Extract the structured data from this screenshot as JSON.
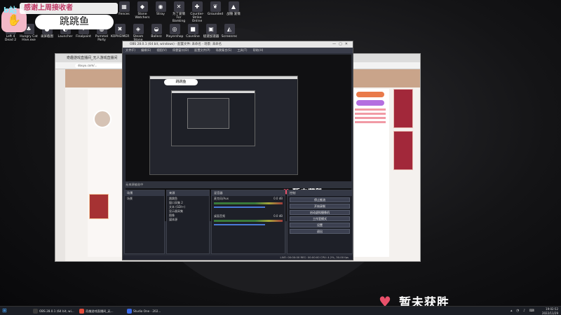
{
  "desktop": {
    "stream_title": "感谢上周接收者",
    "stream_badge": "b站",
    "bubble_text": "跳跳鱼",
    "icons": [
      {
        "label": "Fences",
        "glyph": "▦"
      },
      {
        "label": "Stone Watchers",
        "glyph": "◆"
      },
      {
        "label": "Stray",
        "glyph": "◉"
      },
      {
        "label": "为了爱情 For Banking",
        "glyph": "✕"
      },
      {
        "label": "Counter-Strike Online",
        "glyph": "✚"
      },
      {
        "label": "Grounded",
        "glyph": "❦"
      },
      {
        "label": "战锤 爱情",
        "glyph": "▲"
      },
      {
        "label": "Left 4 Dead 2",
        "glyph": "✶"
      },
      {
        "label": "Hungry Cat Hive.exe",
        "glyph": "♣"
      },
      {
        "label": "录屏截图",
        "glyph": "●"
      },
      {
        "label": "Launcher",
        "glyph": "◐"
      },
      {
        "label": "Finalpoint",
        "glyph": "✦"
      },
      {
        "label": "Pummel Party",
        "glyph": "◍"
      },
      {
        "label": "KOPHEIMER",
        "glyph": "✖"
      },
      {
        "label": "Steam Stone Giant",
        "glyph": "◈"
      },
      {
        "label": "Ballerz",
        "glyph": "◒"
      },
      {
        "label": "Playershop",
        "glyph": "◎"
      },
      {
        "label": "Caveline",
        "glyph": "■"
      },
      {
        "label": "极速加速器",
        "glyph": "▣"
      },
      {
        "label": "Screenrec",
        "glyph": "◭"
      },
      {
        "label": "腾讯 Firefist",
        "glyph": "✗"
      }
    ],
    "status_text": "暂未获胜"
  },
  "browser": {
    "tab_title": "奇趣游戏直播间_无人游戏直播间",
    "url": "douyu.com/..."
  },
  "obs": {
    "title": "OBS 28.0.1 (64 bit, windows) - 配置文件: 未命名 - 场景: 未命名",
    "menu": [
      "文件(F)",
      "编辑(E)",
      "视图(V)",
      "停靠窗口(D)",
      "配置文件(P)",
      "场景集合(S)",
      "工具(T)",
      "帮助(H)"
    ],
    "mini_bubble": "跳跳鱼",
    "preview_status": "暂未获胜",
    "scene_bar": "无来源被选中",
    "docks": {
      "scenes": {
        "title": "场景",
        "items": [
          "场景"
        ]
      },
      "sources": {
        "title": "来源",
        "items": [
          "跳跳鱼",
          "窗口采集 2",
          "文本 (GDI+)",
          "显示器采集",
          "图像",
          "媒体源"
        ]
      },
      "mixer": {
        "title": "混音器",
        "channels": [
          {
            "name": "麦克风/Aux",
            "level": "0.0 dB"
          },
          {
            "name": "桌面音频",
            "level": "0.0 dB"
          }
        ]
      },
      "controls": {
        "title": "控制",
        "buttons": [
          "停止推流",
          "开始录制",
          "启动虚拟摄像机",
          "工作室模式",
          "设置",
          "退出"
        ]
      }
    },
    "statusbar": "LIVE: 00:00:00   REC: 00:00:00   CPU: 4.2%, 30.00 fps"
  },
  "taskbar": {
    "items": [
      {
        "label": "OBS 28.0.1 (64 bit, wi...",
        "color": "#3c3c3c"
      },
      {
        "label": "奇趣游戏直播间_无...",
        "color": "#e24b3a"
      },
      {
        "label": "Studio One - 202...",
        "color": "#3a6ae8"
      }
    ],
    "time": "19:02:52",
    "date": "2022/11/29"
  }
}
